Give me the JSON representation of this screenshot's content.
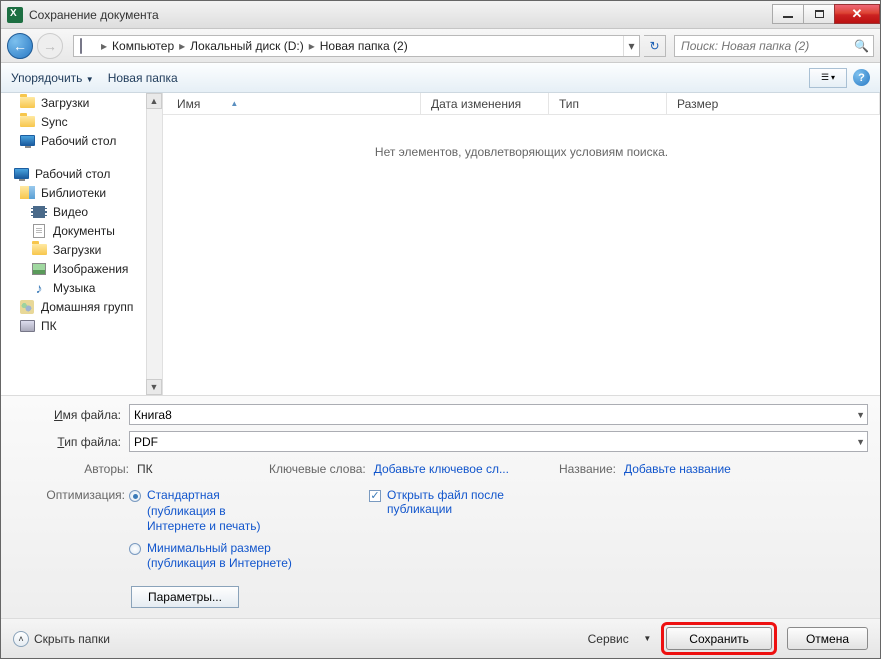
{
  "titlebar": {
    "title": "Сохранение документа"
  },
  "nav": {
    "breadcrumbs": [
      "Компьютер",
      "Локальный диск (D:)",
      "Новая папка (2)"
    ],
    "search_placeholder": "Поиск: Новая папка (2)"
  },
  "toolbar": {
    "organize": "Упорядочить",
    "new_folder": "Новая папка"
  },
  "sidebar": {
    "items1": [
      {
        "label": "Загрузки",
        "icon": "folder"
      },
      {
        "label": "Sync",
        "icon": "folder"
      },
      {
        "label": "Рабочий стол",
        "icon": "monitor"
      }
    ],
    "desktop": "Рабочий стол",
    "libraries": "Библиотеки",
    "libs": [
      {
        "label": "Видео",
        "icon": "film"
      },
      {
        "label": "Документы",
        "icon": "doc"
      },
      {
        "label": "Загрузки",
        "icon": "folder"
      },
      {
        "label": "Изображения",
        "icon": "img"
      },
      {
        "label": "Музыка",
        "icon": "music"
      }
    ],
    "homegroup": "Домашняя групп",
    "pc": "ПК"
  },
  "columns": {
    "name": "Имя",
    "date": "Дата изменения",
    "type": "Тип",
    "size": "Размер"
  },
  "empty": "Нет элементов, удовлетворяющих условиям поиска.",
  "fields": {
    "filename_label_pre": "",
    "filename_label_u": "И",
    "filename_label_post": "мя файла:",
    "filetype_label_pre": "",
    "filetype_label_u": "Т",
    "filetype_label_post": "ип файла:",
    "filename": "Книга8",
    "filetype": "PDF"
  },
  "meta": {
    "authors_label": "Авторы:",
    "authors_value": "ПК",
    "keywords_label": "Ключевые слова:",
    "keywords_value": "Добавьте ключевое сл...",
    "title_label": "Название:",
    "title_value": "Добавьте название"
  },
  "optimize": {
    "label": "Оптимизация:",
    "standard": "Стандартная (публикация в Интернете и печать)",
    "minimal": "Минимальный размер (публикация в Интернете)",
    "open_after": "Открыть файл после публикации",
    "params": "Параметры..."
  },
  "footer": {
    "hide": "Скрыть папки",
    "service": "Сервис",
    "save": "Сохранить",
    "cancel": "Отмена"
  }
}
